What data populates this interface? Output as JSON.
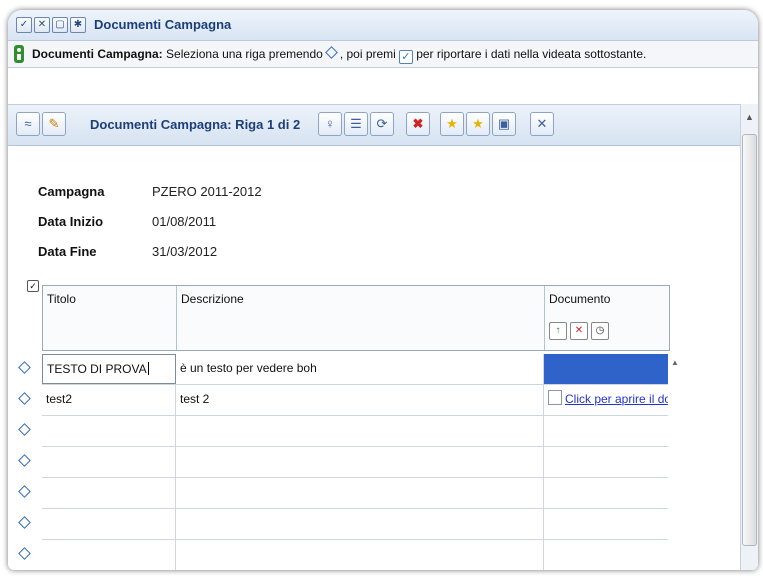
{
  "window": {
    "title": "Documenti Campagna",
    "buttons": [
      "✓",
      "✕",
      "▢",
      "✱"
    ]
  },
  "info": {
    "bold": "Documenti Campagna:",
    "text1": "Seleziona una riga premendo",
    "text2": ", poi premi",
    "text3": "per riportare i dati nella videata sottostante."
  },
  "toolbar": {
    "title": "Documenti Campagna: Riga 1 di 2",
    "icons": [
      "collapse-icon",
      "edit-icon",
      "lightbulb-icon",
      "list-icon",
      "refresh-icon",
      "delete-icon",
      "star-icon",
      "star-add-icon",
      "save-icon",
      "excel-icon"
    ]
  },
  "fields": [
    {
      "label": "Campagna",
      "value": "PZERO 2011-2012"
    },
    {
      "label": "Data Inizio",
      "value": "01/08/2011"
    },
    {
      "label": "Data Fine",
      "value": "31/03/2012"
    }
  ],
  "grid": {
    "columns": [
      "Titolo",
      "Descrizione",
      "Documento"
    ],
    "rows": [
      {
        "titolo": "TESTO DI PROVA",
        "descrizione": "è un testo per vedere boh",
        "documento": ""
      },
      {
        "titolo": "test2",
        "descrizione": "test 2",
        "documento": "Click per aprire il do"
      },
      {
        "titolo": "",
        "descrizione": "",
        "documento": ""
      },
      {
        "titolo": "",
        "descrizione": "",
        "documento": ""
      },
      {
        "titolo": "",
        "descrizione": "",
        "documento": ""
      },
      {
        "titolo": "",
        "descrizione": "",
        "documento": ""
      },
      {
        "titolo": "",
        "descrizione": "",
        "documento": ""
      }
    ]
  },
  "colors": {
    "title": "#1c3f7a",
    "selected_cell": "#2f63c9",
    "link": "#2233cc"
  }
}
